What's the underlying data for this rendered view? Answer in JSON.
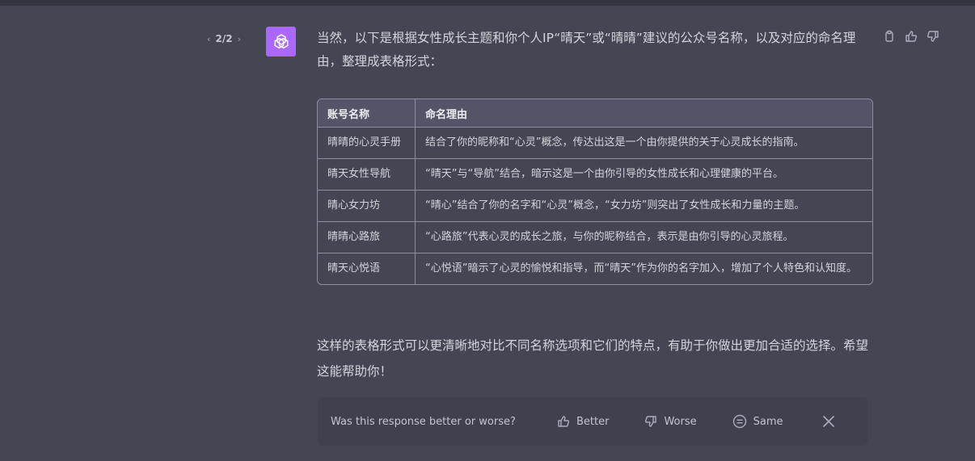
{
  "pager": {
    "text": "2/2",
    "prev": "‹",
    "next": "›"
  },
  "message": {
    "intro": "当然，以下是根据女性成长主题和你个人IP“晴天”或“晴晴”建议的公众号名称，以及对应的命名理由，整理成表格形式：",
    "table": {
      "headers": [
        "账号名称",
        "命名理由"
      ],
      "rows": [
        [
          "晴晴的心灵手册",
          "结合了你的昵称和“心灵”概念，传达出这是一个由你提供的关于心灵成长的指南。"
        ],
        [
          "晴天女性导航",
          "“晴天”与“导航”结合，暗示这是一个由你引导的女性成长和心理健康的平台。"
        ],
        [
          "晴心女力坊",
          "“晴心”结合了你的名字和“心灵”概念，“女力坊”则突出了女性成长和力量的主题。"
        ],
        [
          "晴晴心路旅",
          "“心路旅”代表心灵的成长之旅，与你的昵称结合，表示是由你引导的心灵旅程。"
        ],
        [
          "晴天心悦语",
          "“心悦语”暗示了心灵的愉悦和指导，而“晴天”作为你的名字加入，增加了个人特色和认知度。"
        ]
      ]
    },
    "closing": "这样的表格形式可以更清晰地对比不同名称选项和它们的特点，有助于你做出更加合适的选择。希望这能帮助你！"
  },
  "feedback": {
    "question": "Was this response better or worse?",
    "better": "Better",
    "worse": "Worse",
    "same": "Same"
  },
  "colors": {
    "avatar": "#ab68ff",
    "background": "#444654",
    "panel": "#40414f"
  },
  "icons": [
    "openai-logo-icon",
    "copy-icon",
    "thumbs-up-icon",
    "thumbs-down-icon",
    "equal-circle-icon",
    "close-icon"
  ]
}
